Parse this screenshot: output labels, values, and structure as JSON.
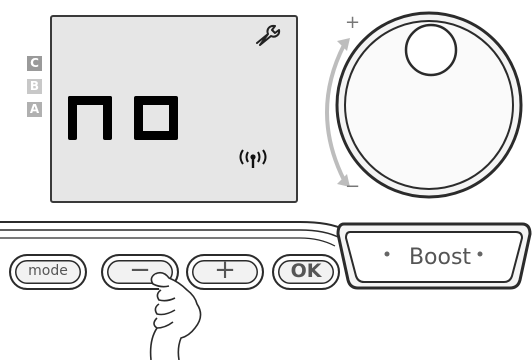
{
  "display": {
    "text": "no",
    "mode_tags": [
      "C",
      "B",
      "A"
    ],
    "icons": [
      "wrench-icon",
      "wireless-signal-icon"
    ]
  },
  "dial": {
    "plus_label": "+",
    "minus_label": "−"
  },
  "buttons": {
    "mode_label": "mode",
    "minus_label": "−",
    "plus_label": "+",
    "ok_label": "OK",
    "boost_label": "Boost"
  },
  "colors": {
    "outline": "#2b2b2b",
    "lcd_background": "#e6e6e6",
    "segment": "#000000",
    "tag_c": "#9a9a9a",
    "tag_b": "#c8c8c8",
    "tag_a": "#b0b0b0"
  }
}
